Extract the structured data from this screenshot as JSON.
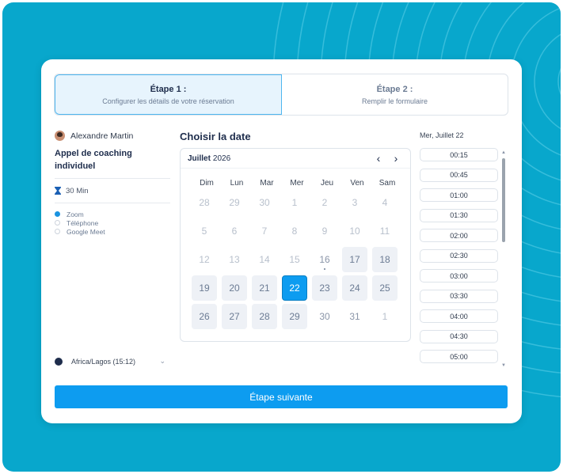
{
  "steps": [
    {
      "title": "Étape 1 :",
      "subtitle": "Configurer les détails de votre réservation"
    },
    {
      "title": "Étape 2 :",
      "subtitle": "Remplir le formulaire"
    }
  ],
  "host": {
    "name": "Alexandre Martin"
  },
  "event": {
    "title": "Appel de coaching individuel",
    "duration": "30 Min"
  },
  "locations": [
    {
      "label": "Zoom",
      "selected": true
    },
    {
      "label": "Téléphone",
      "selected": false
    },
    {
      "label": "Google Meet",
      "selected": false
    }
  ],
  "timezone": {
    "value": "Africa/Lagos (15:12)"
  },
  "calendar": {
    "heading": "Choisir la date",
    "month": "Juillet",
    "year": "2026",
    "weekdays": [
      "Dim",
      "Lun",
      "Mar",
      "Mer",
      "Jeu",
      "Ven",
      "Sam"
    ],
    "weeks": [
      [
        "28",
        "29",
        "30",
        "1",
        "2",
        "3",
        "4"
      ],
      [
        "5",
        "6",
        "7",
        "8",
        "9",
        "10",
        "11"
      ],
      [
        "12",
        "13",
        "14",
        "15",
        "16",
        "17",
        "18"
      ],
      [
        "19",
        "20",
        "21",
        "22",
        "23",
        "24",
        "25"
      ],
      [
        "26",
        "27",
        "28",
        "29",
        "30",
        "31",
        "1"
      ]
    ],
    "available": [
      "17",
      "18",
      "19",
      "20",
      "21",
      "23",
      "24",
      "25",
      "26",
      "27",
      "28",
      "29"
    ],
    "selected": "22",
    "today": "16"
  },
  "slots": {
    "date_label": "Mer, Juillet 22",
    "times": [
      "00:15",
      "00:45",
      "01:00",
      "01:30",
      "02:00",
      "02:30",
      "03:00",
      "03:30",
      "04:00",
      "04:30",
      "05:00"
    ]
  },
  "next_button": {
    "label": "Étape suivante"
  },
  "colors": {
    "background": "#08a7cc",
    "accent": "#0d9cf0",
    "text_dark": "#1e2d4c"
  }
}
